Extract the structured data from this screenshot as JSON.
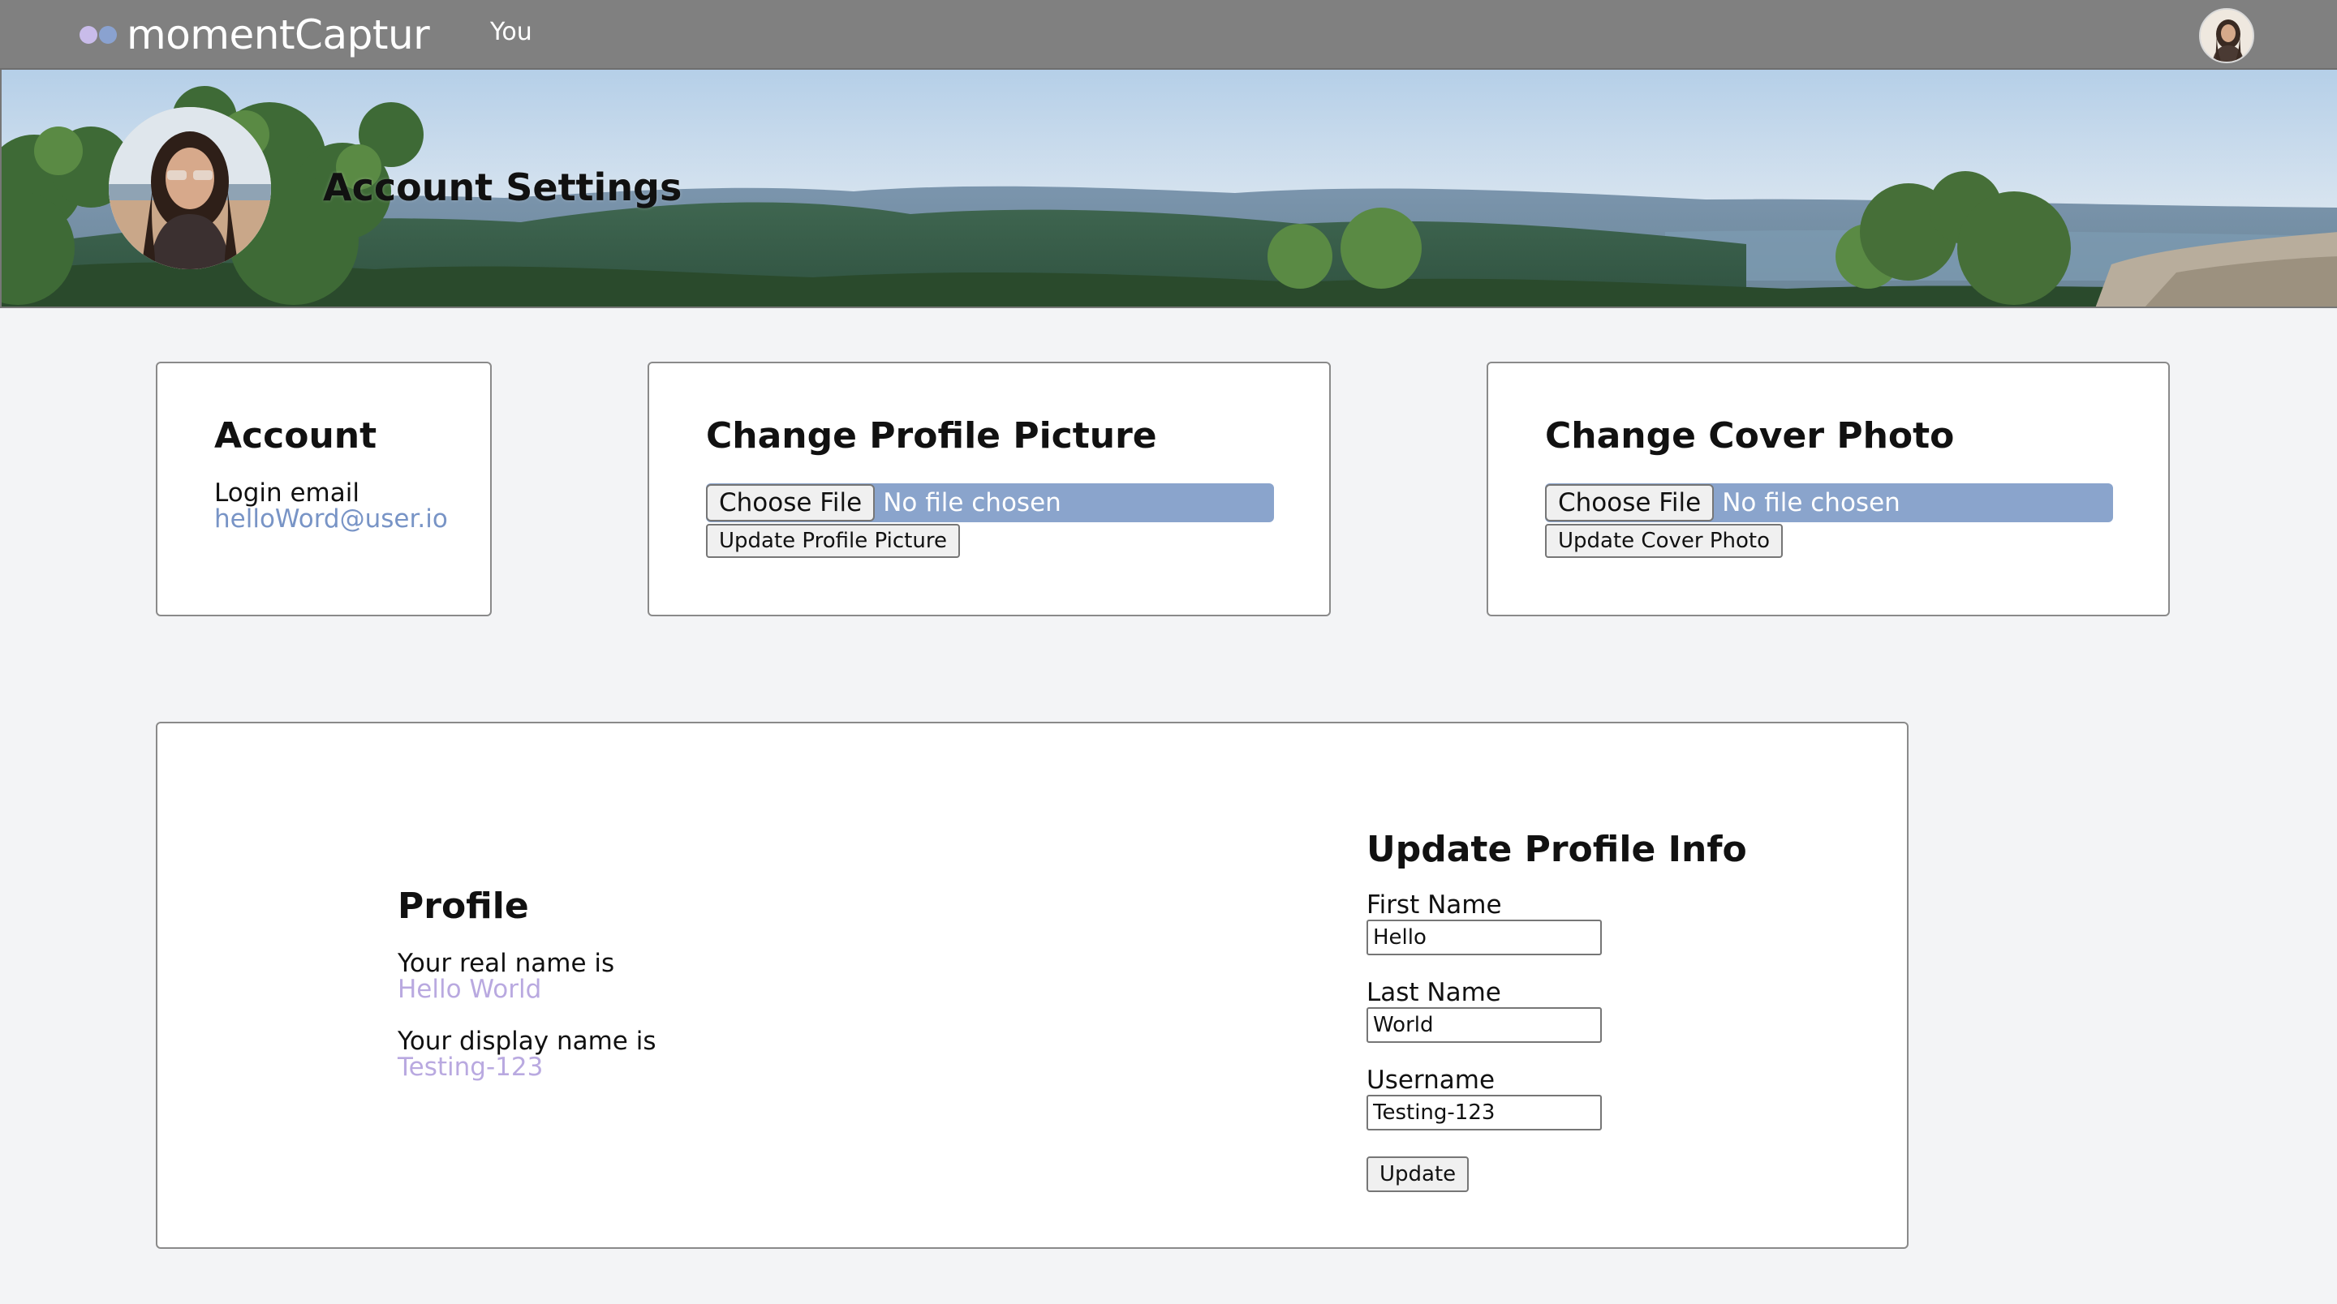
{
  "navbar": {
    "brand": "momentCaptur",
    "nav_you": "You"
  },
  "banner": {
    "title": "Account Settings"
  },
  "account": {
    "title": "Account",
    "login_label": "Login email",
    "email": "helloWord@user.io"
  },
  "profile_picture": {
    "title": "Change Profile Picture",
    "choose_label": "Choose File",
    "status": "No file chosen",
    "update_label": "Update Profile Picture"
  },
  "cover_photo": {
    "title": "Change Cover Photo",
    "choose_label": "Choose File",
    "status": "No file chosen",
    "update_label": "Update Cover Photo"
  },
  "profile": {
    "title": "Profile",
    "real_name_label": "Your real name is",
    "real_name": "Hello World",
    "display_name_label": "Your display name is",
    "display_name": "Testing-123"
  },
  "update_info": {
    "title": "Update Profile Info",
    "first_name_label": "First Name",
    "first_name_value": "Hello",
    "last_name_label": "Last Name",
    "last_name_value": "World",
    "username_label": "Username",
    "username_value": "Testing-123",
    "update_label": "Update"
  },
  "colors": {
    "navbar": "#808080",
    "email_link": "#7894c6",
    "name_accent": "#b9a9e0",
    "file_input": "#8aa4cc"
  },
  "icons": {
    "brand": "two-dots-logo-icon",
    "nav_avatar": "user-avatar-icon"
  }
}
